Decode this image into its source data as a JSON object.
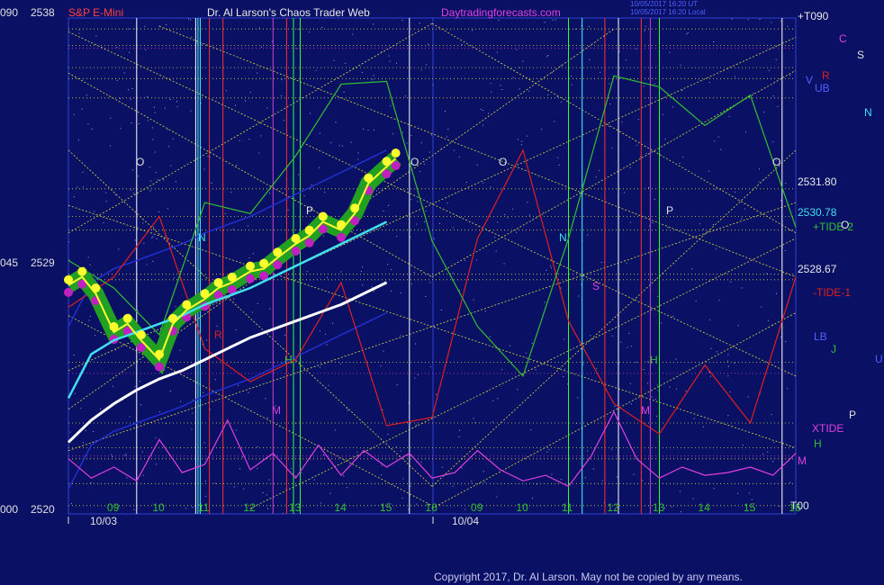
{
  "header": {
    "left_ticker_pct": "090",
    "left_ticker_price": "2538",
    "instrument": "S&P E-Mini",
    "title": "Dr. Al Larson's Chaos Trader Web",
    "site": "Daytradingforecasts.com",
    "stamp_line1": "10/05/2017 16:20 UT",
    "stamp_line2": "10/05/2017 16:20 Local",
    "right_label": "+T090"
  },
  "colors": {
    "background": "#0a1064",
    "price_bars": "#ffff30",
    "ema_cyan": "#40e0f0",
    "trend_white": "#ffffff",
    "tide_red": "#e02020",
    "tide_green": "#30c030",
    "xtide_magenta": "#e040e0",
    "grid_yellow": "#d8d840"
  },
  "chart_data": {
    "type": "line",
    "title": "Dr. Al Larson's Chaos Trader Web",
    "series_label": "S&P E-Mini",
    "y_range": [
      2520,
      2538
    ],
    "left_axis": [
      {
        "pct": "090",
        "price": "2538"
      },
      {
        "pct": "045",
        "price": "2529"
      },
      {
        "pct": "000",
        "price": "2520"
      }
    ],
    "x_hour_labels": [
      "09",
      "10",
      "11",
      "12",
      "13",
      "14",
      "15",
      "16",
      "09",
      "10",
      "11",
      "12",
      "13",
      "14",
      "15",
      "16"
    ],
    "date_labels": [
      "10/03",
      "10/04"
    ],
    "price_labels": [
      "2531.80",
      "2530.78",
      "2528.67"
    ],
    "tide_labels": [
      "+TIDE-2",
      "-TIDE-1",
      "XTIDE",
      "+T090",
      "T00"
    ],
    "planet_letters": [
      "C",
      "S",
      "V",
      "R",
      "N",
      "J",
      "U",
      "P",
      "H",
      "M",
      "O"
    ],
    "bands": [
      "UB",
      "LB"
    ],
    "price_series": [
      {
        "x": 0.0,
        "y": 2528.3
      },
      {
        "x": 0.3,
        "y": 2528.6
      },
      {
        "x": 0.6,
        "y": 2528.0
      },
      {
        "x": 1.0,
        "y": 2526.6
      },
      {
        "x": 1.3,
        "y": 2526.9
      },
      {
        "x": 1.6,
        "y": 2526.3
      },
      {
        "x": 2.0,
        "y": 2525.6
      },
      {
        "x": 2.3,
        "y": 2526.9
      },
      {
        "x": 2.6,
        "y": 2527.4
      },
      {
        "x": 3.0,
        "y": 2527.8
      },
      {
        "x": 3.3,
        "y": 2528.2
      },
      {
        "x": 3.6,
        "y": 2528.4
      },
      {
        "x": 4.0,
        "y": 2528.8
      },
      {
        "x": 4.3,
        "y": 2528.9
      },
      {
        "x": 4.6,
        "y": 2529.3
      },
      {
        "x": 5.0,
        "y": 2529.8
      },
      {
        "x": 5.3,
        "y": 2530.1
      },
      {
        "x": 5.6,
        "y": 2530.6
      },
      {
        "x": 6.0,
        "y": 2530.3
      },
      {
        "x": 6.3,
        "y": 2530.9
      },
      {
        "x": 6.6,
        "y": 2532.0
      },
      {
        "x": 7.0,
        "y": 2532.6
      },
      {
        "x": 7.2,
        "y": 2532.9
      }
    ],
    "ema_series": [
      {
        "x": 0.0,
        "y": 2524.2
      },
      {
        "x": 0.5,
        "y": 2525.8
      },
      {
        "x": 1.0,
        "y": 2526.3
      },
      {
        "x": 1.5,
        "y": 2526.6
      },
      {
        "x": 2.0,
        "y": 2526.9
      },
      {
        "x": 2.5,
        "y": 2527.2
      },
      {
        "x": 3.0,
        "y": 2527.6
      },
      {
        "x": 3.5,
        "y": 2527.9
      },
      {
        "x": 4.0,
        "y": 2528.2
      },
      {
        "x": 4.5,
        "y": 2528.6
      },
      {
        "x": 5.0,
        "y": 2529.0
      },
      {
        "x": 5.5,
        "y": 2529.4
      },
      {
        "x": 6.0,
        "y": 2529.8
      },
      {
        "x": 6.5,
        "y": 2530.2
      },
      {
        "x": 7.0,
        "y": 2530.6
      }
    ],
    "trend_series": [
      {
        "x": 0.0,
        "y": 2522.6
      },
      {
        "x": 0.5,
        "y": 2523.4
      },
      {
        "x": 1.0,
        "y": 2524.0
      },
      {
        "x": 1.5,
        "y": 2524.5
      },
      {
        "x": 2.0,
        "y": 2524.9
      },
      {
        "x": 2.5,
        "y": 2525.2
      },
      {
        "x": 3.0,
        "y": 2525.6
      },
      {
        "x": 3.5,
        "y": 2526.0
      },
      {
        "x": 4.0,
        "y": 2526.4
      },
      {
        "x": 4.5,
        "y": 2526.7
      },
      {
        "x": 5.0,
        "y": 2527.0
      },
      {
        "x": 5.5,
        "y": 2527.3
      },
      {
        "x": 6.0,
        "y": 2527.6
      },
      {
        "x": 6.5,
        "y": 2528.0
      },
      {
        "x": 7.0,
        "y": 2528.4
      }
    ],
    "tide_red_series": [
      {
        "x": 0.0,
        "y": 2527.5
      },
      {
        "x": 1.0,
        "y": 2528.6
      },
      {
        "x": 2.0,
        "y": 2530.8
      },
      {
        "x": 3.0,
        "y": 2526.0
      },
      {
        "x": 4.0,
        "y": 2524.8
      },
      {
        "x": 5.0,
        "y": 2525.6
      },
      {
        "x": 6.0,
        "y": 2528.4
      },
      {
        "x": 7.0,
        "y": 2523.2
      },
      {
        "x": 8.0,
        "y": 2523.5
      },
      {
        "x": 9.0,
        "y": 2530.0
      },
      {
        "x": 10.0,
        "y": 2533.2
      },
      {
        "x": 11.0,
        "y": 2527.0
      },
      {
        "x": 12.0,
        "y": 2524.0
      },
      {
        "x": 13.0,
        "y": 2522.9
      },
      {
        "x": 14.0,
        "y": 2525.4
      },
      {
        "x": 15.0,
        "y": 2523.3
      },
      {
        "x": 16.0,
        "y": 2528.6
      }
    ],
    "tide_green_series": [
      {
        "x": 0.0,
        "y": 2529.2
      },
      {
        "x": 1.0,
        "y": 2528.2
      },
      {
        "x": 2.0,
        "y": 2526.5
      },
      {
        "x": 3.0,
        "y": 2531.3
      },
      {
        "x": 4.0,
        "y": 2530.9
      },
      {
        "x": 5.0,
        "y": 2533.0
      },
      {
        "x": 6.0,
        "y": 2535.6
      },
      {
        "x": 7.0,
        "y": 2535.7
      },
      {
        "x": 8.0,
        "y": 2529.9
      },
      {
        "x": 9.0,
        "y": 2526.8
      },
      {
        "x": 10.0,
        "y": 2525.0
      },
      {
        "x": 11.0,
        "y": 2530.0
      },
      {
        "x": 12.0,
        "y": 2535.9
      },
      {
        "x": 13.0,
        "y": 2535.5
      },
      {
        "x": 14.0,
        "y": 2534.1
      },
      {
        "x": 15.0,
        "y": 2535.2
      },
      {
        "x": 16.0,
        "y": 2530.4
      }
    ],
    "xtide_series": [
      {
        "x": 0.0,
        "y": 2522.0
      },
      {
        "x": 0.5,
        "y": 2521.3
      },
      {
        "x": 1.0,
        "y": 2521.7
      },
      {
        "x": 1.5,
        "y": 2521.2
      },
      {
        "x": 2.0,
        "y": 2522.7
      },
      {
        "x": 2.5,
        "y": 2521.5
      },
      {
        "x": 3.0,
        "y": 2521.8
      },
      {
        "x": 3.5,
        "y": 2523.4
      },
      {
        "x": 4.0,
        "y": 2521.6
      },
      {
        "x": 4.5,
        "y": 2522.2
      },
      {
        "x": 5.0,
        "y": 2521.3
      },
      {
        "x": 5.5,
        "y": 2522.5
      },
      {
        "x": 6.0,
        "y": 2521.4
      },
      {
        "x": 6.5,
        "y": 2522.3
      },
      {
        "x": 7.0,
        "y": 2521.7
      },
      {
        "x": 7.5,
        "y": 2522.2
      },
      {
        "x": 8.0,
        "y": 2521.3
      },
      {
        "x": 8.5,
        "y": 2521.5
      },
      {
        "x": 9.0,
        "y": 2522.3
      },
      {
        "x": 9.5,
        "y": 2521.6
      },
      {
        "x": 10.0,
        "y": 2521.2
      },
      {
        "x": 10.5,
        "y": 2521.4
      },
      {
        "x": 11.0,
        "y": 2521.0
      },
      {
        "x": 11.5,
        "y": 2522.1
      },
      {
        "x": 12.0,
        "y": 2523.7
      },
      {
        "x": 12.5,
        "y": 2522.0
      },
      {
        "x": 13.0,
        "y": 2521.3
      },
      {
        "x": 13.5,
        "y": 2521.7
      },
      {
        "x": 14.0,
        "y": 2521.4
      },
      {
        "x": 14.5,
        "y": 2521.5
      },
      {
        "x": 15.0,
        "y": 2521.7
      },
      {
        "x": 15.5,
        "y": 2521.4
      },
      {
        "x": 16.0,
        "y": 2522.2
      }
    ]
  },
  "footer": {
    "copyright": "Copyright 2017, Dr. Al Larson. May not be copied by any means."
  }
}
